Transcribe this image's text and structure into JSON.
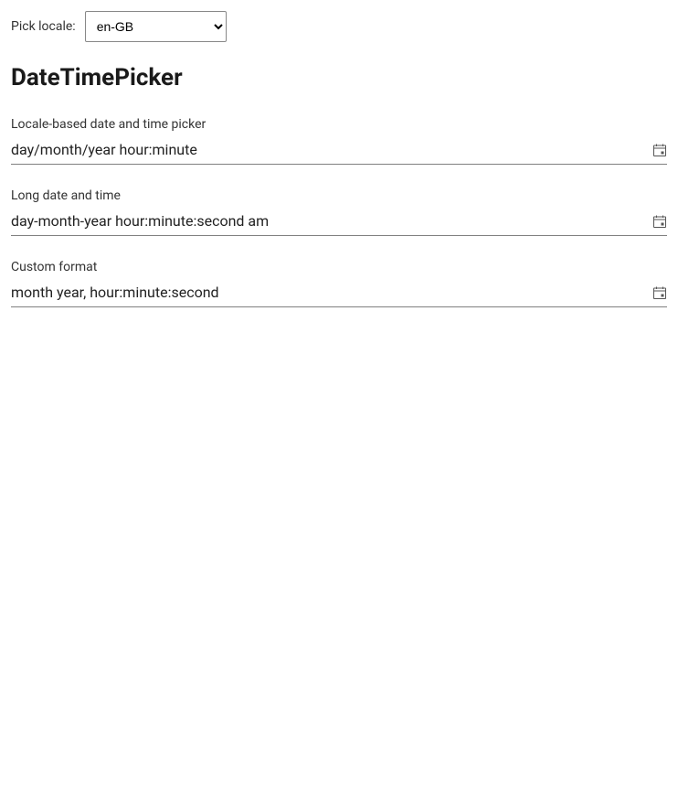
{
  "locale": {
    "label": "Pick locale:",
    "selected": "en-GB"
  },
  "title": "DateTimePicker",
  "pickers": [
    {
      "label": "Locale-based date and time picker",
      "placeholder": "day/month/year hour:minute"
    },
    {
      "label": "Long date and time",
      "placeholder": "day-month-year hour:minute:second am"
    },
    {
      "label": "Custom format",
      "placeholder": "month year, hour:minute:second"
    }
  ]
}
